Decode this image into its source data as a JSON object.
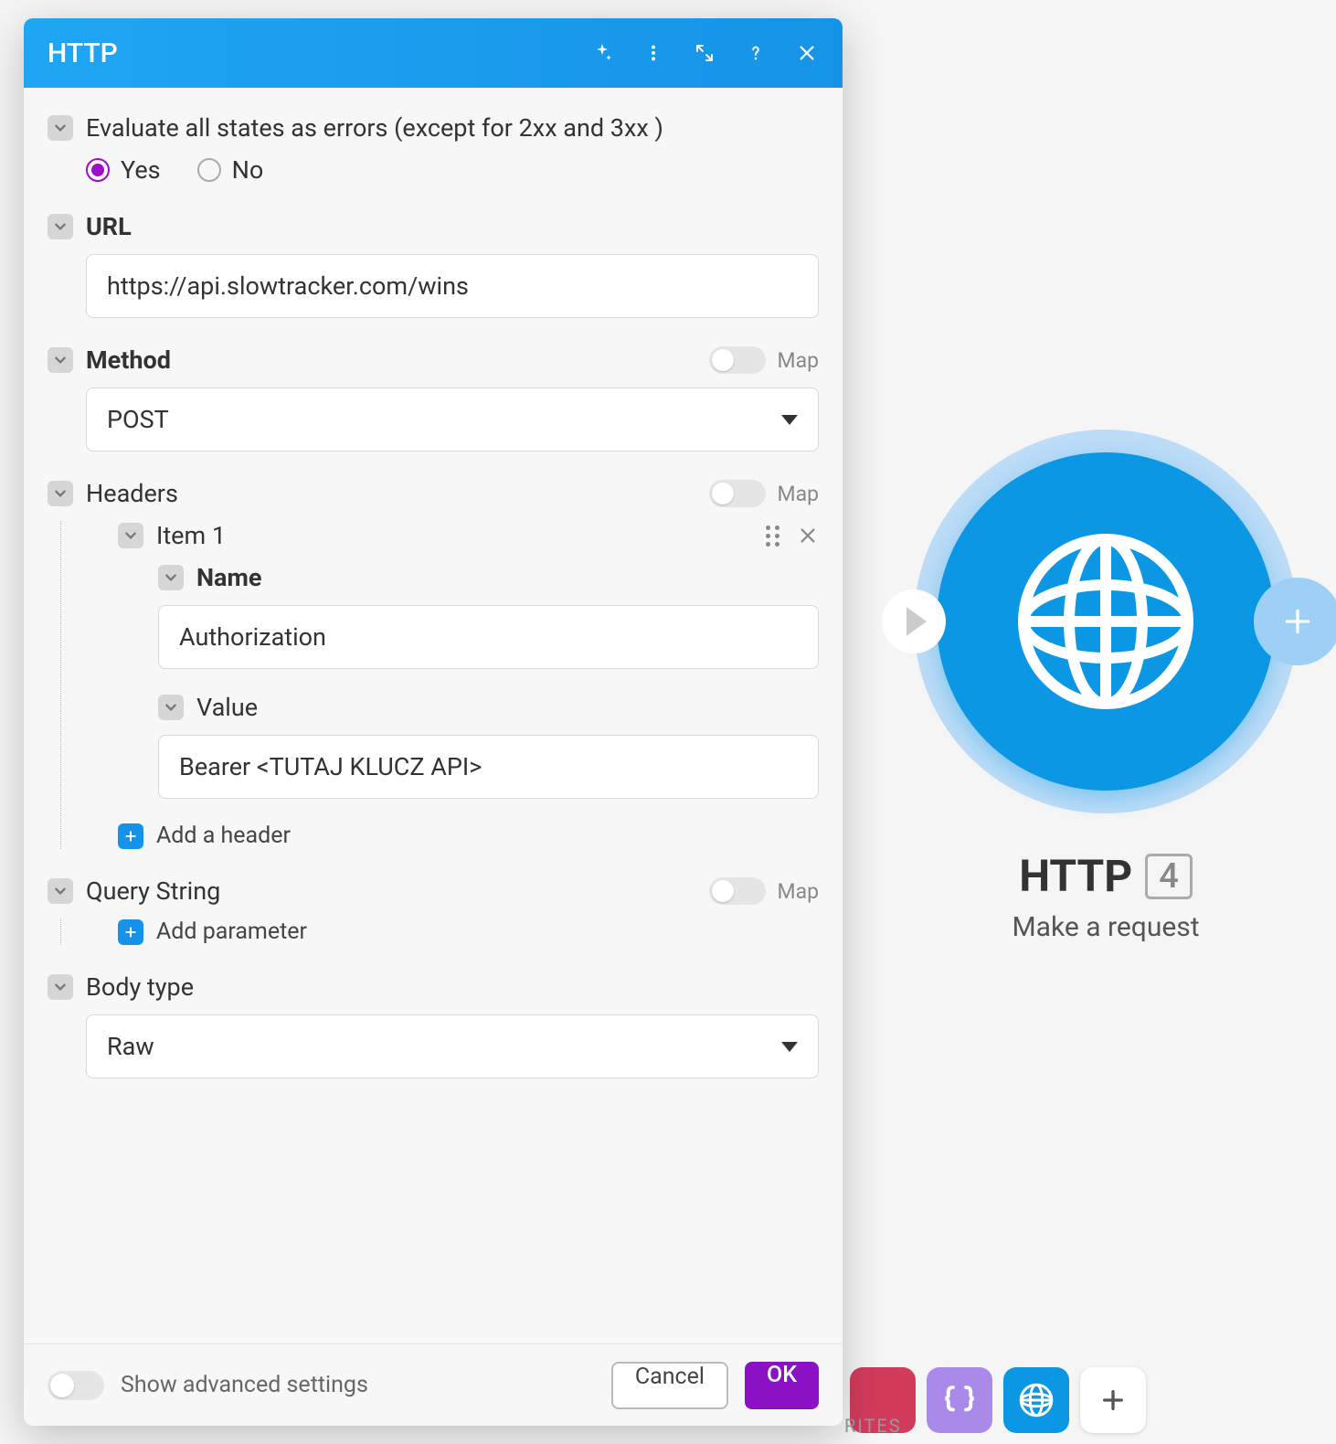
{
  "modal": {
    "title": "HTTP",
    "evaluate_errors": {
      "label": "Evaluate all states as errors (except for 2xx and 3xx )",
      "options": {
        "yes": "Yes",
        "no": "No"
      },
      "selected": "yes"
    },
    "url": {
      "label": "URL",
      "value": "https://api.slowtracker.com/wins"
    },
    "method": {
      "label": "Method",
      "map_label": "Map",
      "value": "POST"
    },
    "headers": {
      "label": "Headers",
      "map_label": "Map",
      "items": [
        {
          "title": "Item 1",
          "name_label": "Name",
          "name_value": "Authorization",
          "value_label": "Value",
          "value_value": "Bearer <TUTAJ KLUCZ API>"
        }
      ],
      "add_label": "Add a header"
    },
    "query_string": {
      "label": "Query String",
      "map_label": "Map",
      "add_label": "Add parameter"
    },
    "body_type": {
      "label": "Body type",
      "value": "Raw"
    },
    "footer": {
      "advanced_label": "Show advanced settings",
      "cancel": "Cancel",
      "ok": "OK"
    }
  },
  "node": {
    "title": "HTTP",
    "badge": "4",
    "subtitle": "Make a request"
  },
  "toolbar": {
    "caption": "RITES"
  }
}
